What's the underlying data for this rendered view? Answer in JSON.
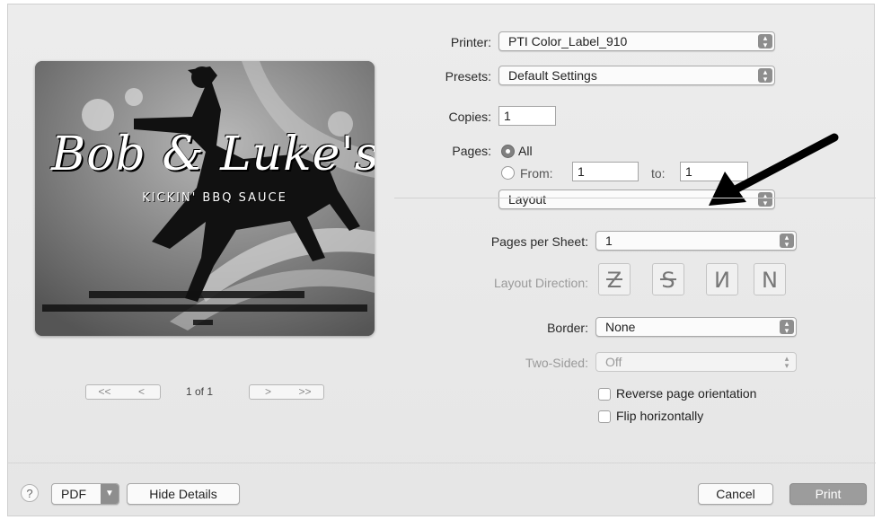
{
  "printer": {
    "label": "Printer:",
    "value": "PTI Color_Label_910"
  },
  "presets": {
    "label": "Presets:",
    "value": "Default Settings"
  },
  "copies": {
    "label": "Copies:",
    "value": "1"
  },
  "pages": {
    "label": "Pages:",
    "all_label": "All",
    "from_label": "From:",
    "from_value": "1",
    "to_label": "to:",
    "to_value": "1",
    "selected": "All"
  },
  "section_menu": {
    "value": "Layout"
  },
  "layout": {
    "pages_per_sheet": {
      "label": "Pages per Sheet:",
      "value": "1"
    },
    "layout_direction": {
      "label": "Layout Direction:"
    },
    "border": {
      "label": "Border:",
      "value": "None"
    },
    "two_sided": {
      "label": "Two-Sided:",
      "value": "Off"
    },
    "reverse": {
      "label": "Reverse page orientation",
      "checked": false
    },
    "flip": {
      "label": "Flip horizontally",
      "checked": false
    }
  },
  "preview": {
    "title": "Bob & Luke's",
    "subtitle": "KICKIN' BBQ SAUCE",
    "page_indicator": "1 of 1",
    "nav_first": "<<",
    "nav_prev": "<",
    "nav_next": ">",
    "nav_last": ">>"
  },
  "footer": {
    "help": "?",
    "pdf": "PDF",
    "hide_details": "Hide Details",
    "cancel": "Cancel",
    "print": "Print"
  },
  "colors": {
    "accent": "#8e8e8e",
    "print_button": "#9c9c9c"
  }
}
